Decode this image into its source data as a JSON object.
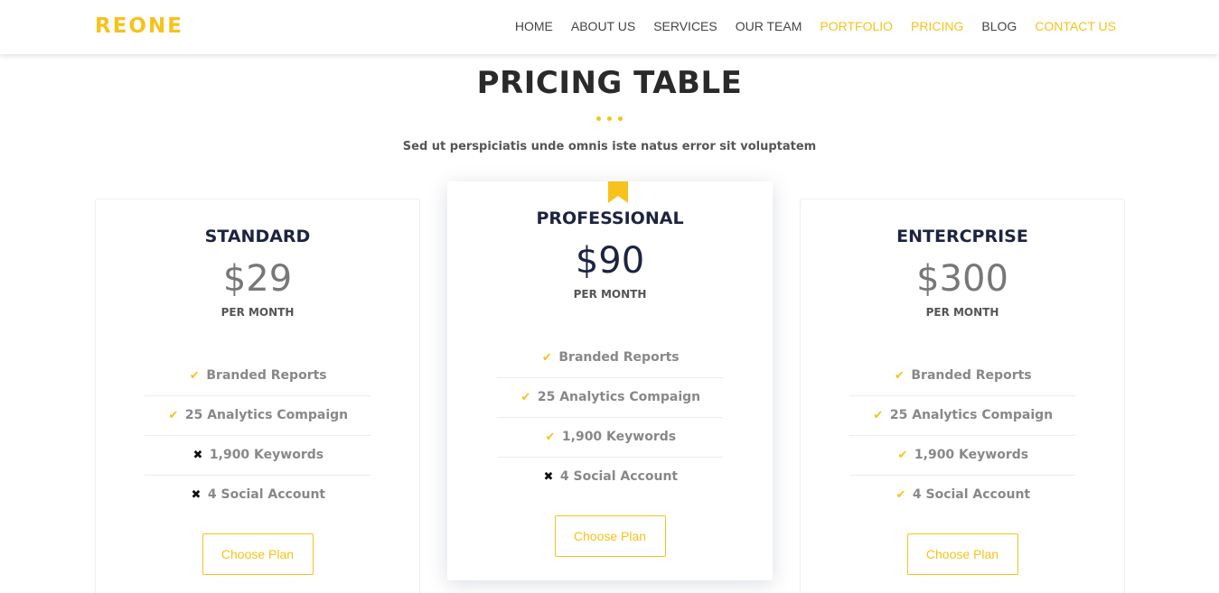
{
  "brand": {
    "logo": "REONE"
  },
  "nav": {
    "items": [
      {
        "label": "HOME",
        "active": false
      },
      {
        "label": "ABOUT US",
        "active": false
      },
      {
        "label": "SERVICES",
        "active": false
      },
      {
        "label": "OUR TEAM",
        "active": false
      },
      {
        "label": "PORTFOLIO",
        "active": true
      },
      {
        "label": "PRICING",
        "active": true
      },
      {
        "label": "BLOG",
        "active": false
      },
      {
        "label": "CONTACT US",
        "active": true
      }
    ]
  },
  "section": {
    "title": "PRICING TABLE",
    "subtitle": "Sed ut perspiciatis unde omnis iste natus error sit voluptatem"
  },
  "colors": {
    "accent": "#f7c21b",
    "heading": "#1d2440",
    "muted": "#888888"
  },
  "plans": [
    {
      "name": "STANDARD",
      "price": "$29",
      "period": "PER MONTH",
      "featured": false,
      "features": [
        {
          "label": "Branded Reports",
          "included": true,
          "icon": "check-icon"
        },
        {
          "label": "25 Analytics Compaign",
          "included": true,
          "icon": "check-icon"
        },
        {
          "label": "1,900 Keywords",
          "included": false,
          "icon": "cross-icon"
        },
        {
          "label": "4 Social Account",
          "included": false,
          "icon": "cross-icon"
        }
      ],
      "button": "Choose Plan"
    },
    {
      "name": "PROFESSIONAL",
      "price": "$90",
      "period": "PER MONTH",
      "featured": true,
      "features": [
        {
          "label": "Branded Reports",
          "included": true,
          "icon": "check-icon"
        },
        {
          "label": "25 Analytics Compaign",
          "included": true,
          "icon": "check-icon"
        },
        {
          "label": "1,900 Keywords",
          "included": true,
          "icon": "check-icon"
        },
        {
          "label": "4 Social Account",
          "included": false,
          "icon": "cross-icon"
        }
      ],
      "button": "Choose Plan"
    },
    {
      "name": "ENTERCPRISE",
      "price": "$300",
      "period": "PER MONTH",
      "featured": false,
      "features": [
        {
          "label": "Branded Reports",
          "included": true,
          "icon": "check-icon"
        },
        {
          "label": "25 Analytics Compaign",
          "included": true,
          "icon": "check-icon"
        },
        {
          "label": "1,900 Keywords",
          "included": true,
          "icon": "check-icon"
        },
        {
          "label": "4 Social Account",
          "included": true,
          "icon": "check-icon"
        }
      ],
      "button": "Choose Plan"
    }
  ]
}
